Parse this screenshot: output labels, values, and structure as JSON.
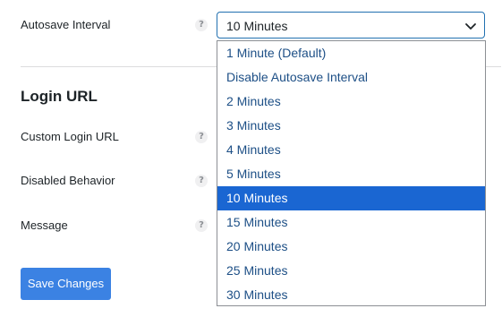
{
  "autosave": {
    "label": "Autosave Interval",
    "help": "?",
    "selected_value": "10 Minutes",
    "options": [
      "1 Minute (Default)",
      "Disable Autosave Interval",
      "2 Minutes",
      "3 Minutes",
      "4 Minutes",
      "5 Minutes",
      "10 Minutes",
      "15 Minutes",
      "20 Minutes",
      "25 Minutes",
      "30 Minutes"
    ],
    "highlighted_option": "10 Minutes",
    "dropdown_icon": "chevron-down-icon"
  },
  "login_url": {
    "title": "Login URL",
    "rows": [
      {
        "label": "Custom Login URL",
        "help": "?"
      },
      {
        "label": "Disabled Behavior",
        "help": "?"
      },
      {
        "label": "Message",
        "help": "?"
      }
    ]
  },
  "actions": {
    "save_label": "Save Changes"
  },
  "colors": {
    "accent": "#2271b1",
    "highlight": "#1a66d2",
    "button": "#3b82e3",
    "option_text": "#1d4f86"
  }
}
